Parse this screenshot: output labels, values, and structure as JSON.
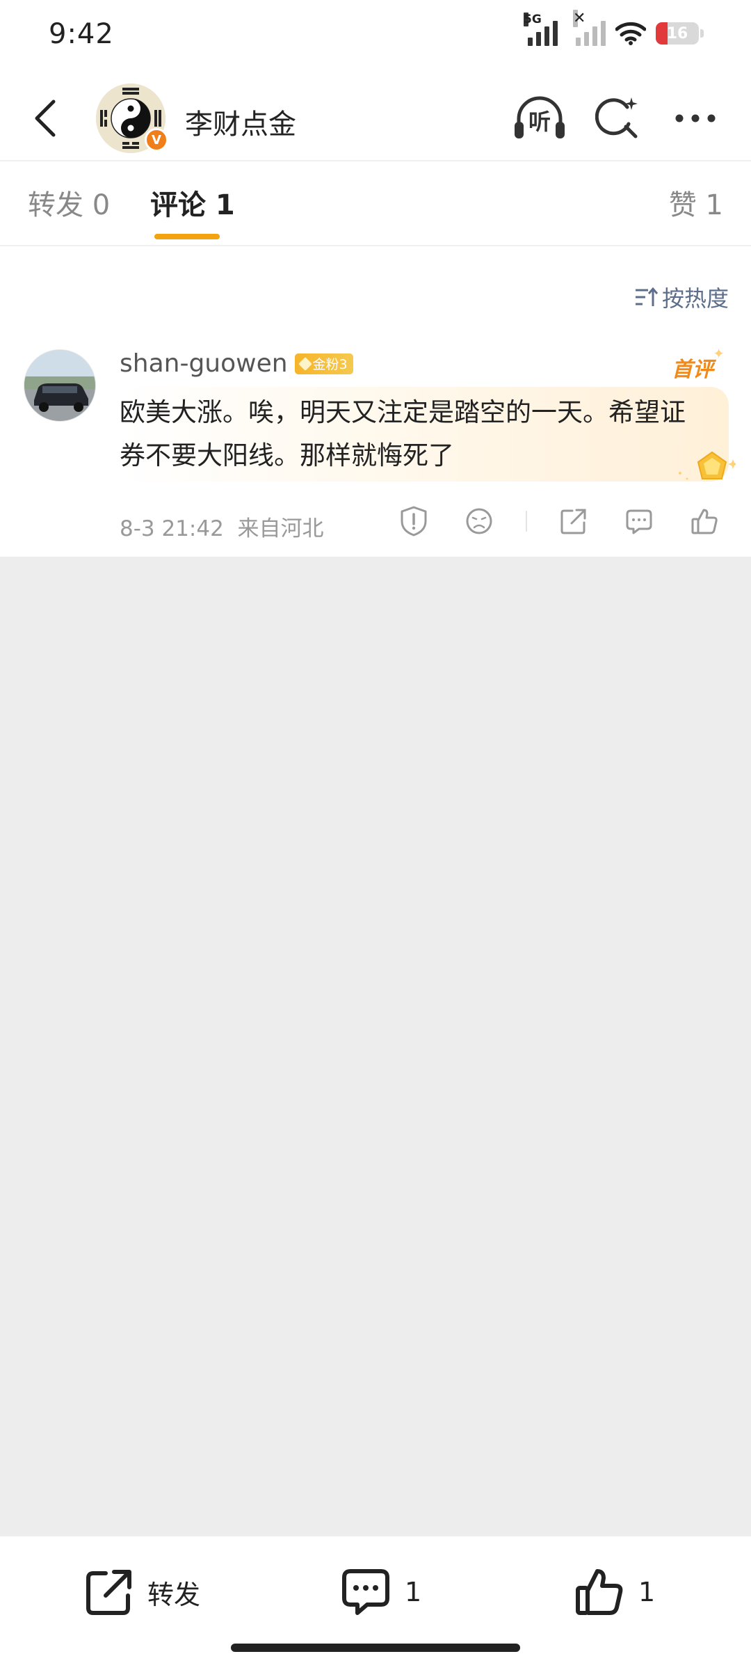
{
  "status_bar": {
    "time": "9:42",
    "network": "5G",
    "battery": "16",
    "battery_level": 0.16,
    "icons": [
      "signal-5g-icon",
      "signal-no-service-icon",
      "wifi-icon",
      "battery-icon"
    ]
  },
  "header": {
    "title": "李财点金",
    "verified_mark": "V",
    "back_icon": "chevron-left-icon",
    "avatar_icon": "yin-yang-bagua-avatar",
    "listen_label": "听",
    "actions": [
      "listen-icon",
      "search-sparkle-icon",
      "more-icon"
    ]
  },
  "tabs": {
    "repost": "转发 0",
    "comments": "评论 1",
    "likes": "赞 1",
    "active_color": "#f2a30f"
  },
  "sort": {
    "label": "按热度",
    "icon": "sort-icon",
    "color": "#5c6e8c"
  },
  "comment": {
    "username": "shan-guowen",
    "fan_badge": "金粉3",
    "first_badge": "首评",
    "text": "欧美大涨。唉，明天又注定是踏空的一天。希望证券不要大阳线。那样就悔死了",
    "time": "8-3 21:42",
    "location": "来自河北",
    "action_icons": [
      "report-icon",
      "dislike-face-icon",
      "share-icon",
      "reply-icon",
      "like-icon"
    ],
    "accent_color": "#f08a1b"
  },
  "bottom_bar": {
    "repost_label": "转发",
    "comment_count": "1",
    "like_count": "1",
    "icons": [
      "share-icon",
      "comment-icon",
      "like-icon"
    ]
  }
}
